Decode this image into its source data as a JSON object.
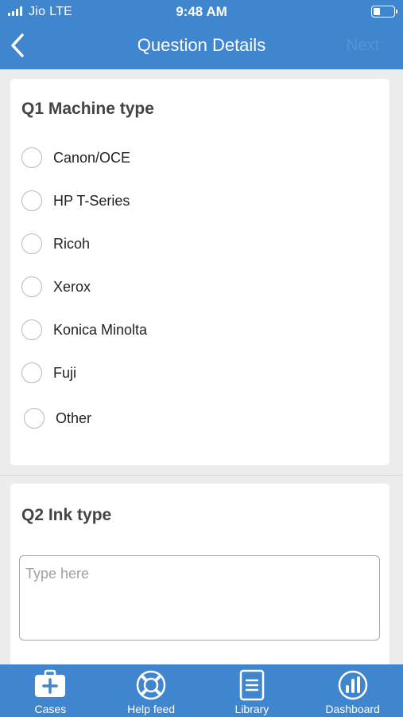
{
  "status_bar": {
    "carrier": "Jio  LTE",
    "time": "9:48 AM"
  },
  "header": {
    "title": "Question Details",
    "next_label": "Next"
  },
  "questions": [
    {
      "title": "Q1 Machine type",
      "options": [
        "Canon/OCE",
        "HP T-Series",
        "Ricoh",
        "Xerox",
        "Konica Minolta",
        "Fuji",
        "Other"
      ]
    },
    {
      "title": "Q2 Ink type",
      "placeholder": "Type here",
      "value": ""
    }
  ],
  "tabbar": {
    "items": [
      {
        "label": "Cases",
        "icon": "medical-case-icon"
      },
      {
        "label": "Help feed",
        "icon": "lifebuoy-icon"
      },
      {
        "label": "Library",
        "icon": "document-icon"
      },
      {
        "label": "Dashboard",
        "icon": "bar-chart-icon"
      }
    ]
  },
  "colors": {
    "primary": "#3f86cf",
    "background": "#ececec",
    "card": "#ffffff"
  }
}
